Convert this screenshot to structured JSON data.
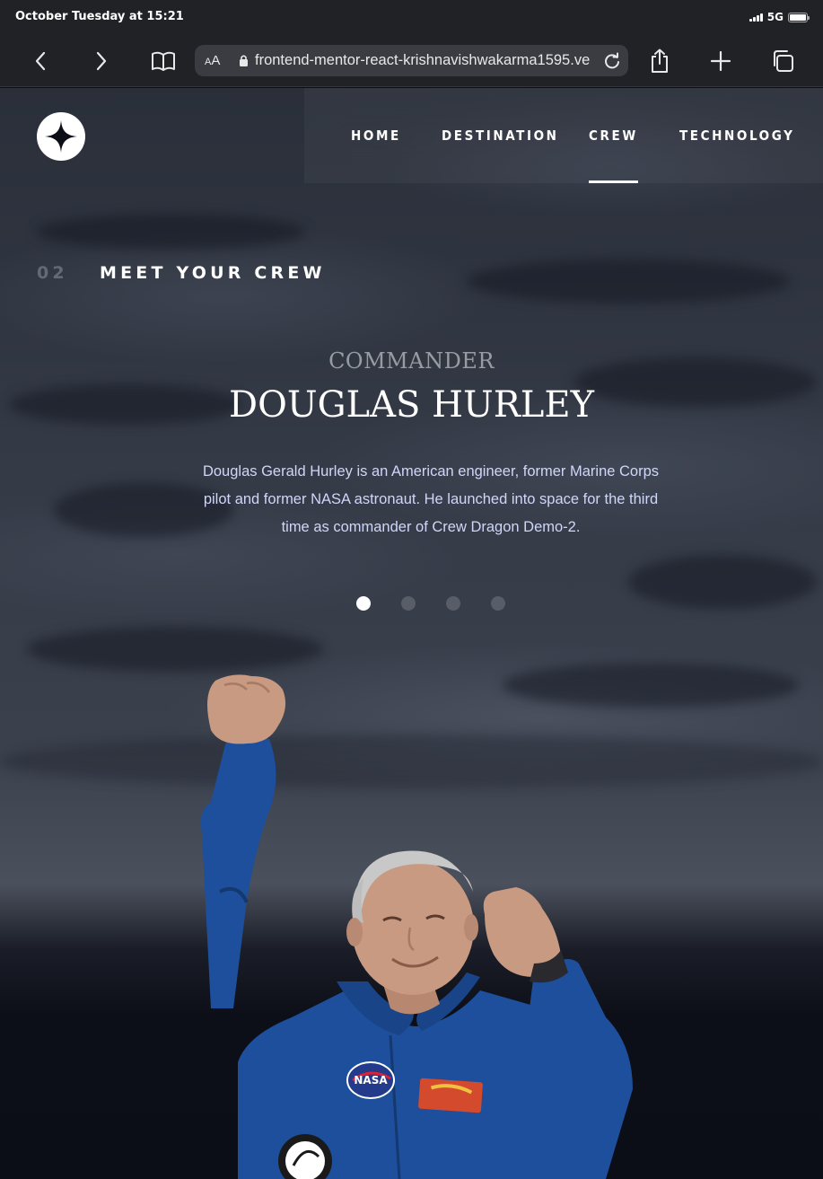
{
  "status_bar": {
    "time": "October Tuesday at 15:21",
    "network": "5G"
  },
  "browser": {
    "text_size_label": "AA",
    "url": "frontend-mentor-react-krishnavishwakarma1595.ve"
  },
  "nav": {
    "items": [
      {
        "label": "HOME",
        "active": false
      },
      {
        "label": "DESTINATION",
        "active": false
      },
      {
        "label": "CREW",
        "active": true
      },
      {
        "label": "TECHNOLOGY",
        "active": false
      }
    ]
  },
  "section": {
    "number": "02",
    "title": "MEET YOUR CREW"
  },
  "crew": {
    "role": "COMMANDER",
    "name": "DOUGLAS HURLEY",
    "bio": "Douglas Gerald Hurley is an American engineer, former Marine Corps pilot and former NASA astronaut. He launched into space for the third time as commander of Crew Dragon Demo-2.",
    "selected_index": 0,
    "count": 4,
    "badge_text": "NASA"
  },
  "colors": {
    "background": "#0b0d17",
    "body_text": "#d0d6f9",
    "accent": "#ffffff",
    "suit_blue": "#1e4f9c"
  }
}
